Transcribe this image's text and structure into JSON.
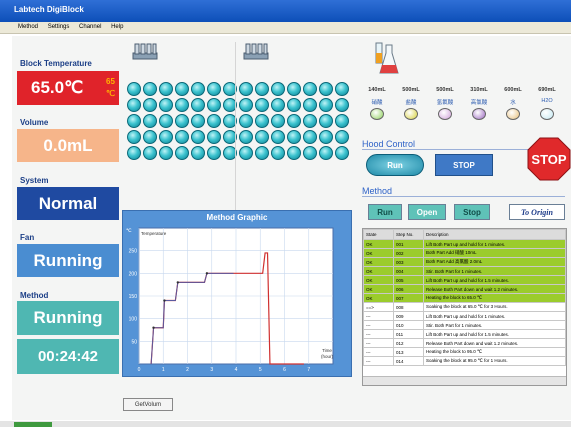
{
  "window": {
    "title": "Labtech DigiBlock"
  },
  "menu": [
    "Method",
    "Settings",
    "Channel",
    "Help"
  ],
  "left": {
    "block_temperature_label": "Block Temperature",
    "block_temperature": "65.0℃",
    "block_setpoint": "65",
    "block_setpoint_unit": "℃",
    "volume_label": "Volume",
    "volume": "0.0mL",
    "system_label": "System",
    "system": "Normal",
    "fan_label": "Fan",
    "fan": "Running",
    "method_label": "Method",
    "method": "Running",
    "elapsed": "00:24:42"
  },
  "reagents": [
    {
      "volume": "140mL",
      "name": "硝酸",
      "color": "#8ed05a"
    },
    {
      "volume": "500mL",
      "name": "盐酸",
      "color": "#d8d23b"
    },
    {
      "volume": "500mL",
      "name": "氢氟酸",
      "color": "#cfa0d8"
    },
    {
      "volume": "310mL",
      "name": "高氯酸",
      "color": "#9a66c0"
    },
    {
      "volume": "600mL",
      "name": "水",
      "color": "#e8c07a"
    },
    {
      "volume": "690mL",
      "name": "H2O",
      "color": "#c3e8f2"
    }
  ],
  "hood": {
    "label": "Hood Control",
    "run": "Run",
    "stop": "STOP"
  },
  "stop_sign": "STOP",
  "method_panel": {
    "label": "Method",
    "run": "Run",
    "open": "Open",
    "stop": "Stop",
    "origin": "To Origin"
  },
  "steps": {
    "headers": [
      "State",
      "Step No.",
      "Description"
    ],
    "rows": [
      {
        "state": "OK",
        "no": "001",
        "desc": "Lift Both Part up and hold for 1 minutes.",
        "done": true
      },
      {
        "state": "OK",
        "no": "002",
        "desc": "Both Part Add 硝酸 10mL",
        "done": true
      },
      {
        "state": "OK",
        "no": "003",
        "desc": "Both Part Add 高氯酸 2.0mL",
        "done": true
      },
      {
        "state": "OK",
        "no": "004",
        "desc": "Stir. Both Part for 1 minutes.",
        "done": true
      },
      {
        "state": "OK",
        "no": "005",
        "desc": "Lift Both Part up and hold for 1.5 minutes.",
        "done": true
      },
      {
        "state": "OK",
        "no": "006",
        "desc": "Release Both Part down and wait 1.2 minutes.",
        "done": true
      },
      {
        "state": "OK",
        "no": "007",
        "desc": "Heating the block to 65.0 ℃",
        "done": true
      },
      {
        "state": "==>",
        "no": "008",
        "desc": "Soaking the block at 65.0 ℃ for 3 Hours.",
        "done": false
      },
      {
        "state": "---",
        "no": "009",
        "desc": "Lift Both Part up and hold for 1 minutes.",
        "done": false
      },
      {
        "state": "---",
        "no": "010",
        "desc": "Stir. Both Part for 1 minutes.",
        "done": false
      },
      {
        "state": "---",
        "no": "011",
        "desc": "Lift Both Part up and hold for 1.5 minutes.",
        "done": false
      },
      {
        "state": "---",
        "no": "012",
        "desc": "Release Both Part down and wait 1.2 minutes.",
        "done": false
      },
      {
        "state": "---",
        "no": "013",
        "desc": "Heating the block to 95.0 ℃",
        "done": false
      },
      {
        "state": "---",
        "no": "014",
        "desc": "Soaking the block at 95.0 ℃ for 1 Hours.",
        "done": false
      }
    ]
  },
  "get_volume": "GetVolum",
  "chart_data": {
    "type": "line",
    "title": "Method Graphic",
    "ylabel": "Temperature",
    "y_unit": "℃",
    "xlabel": "Time",
    "x_unit": "(hour)",
    "xlim": [
      0,
      8
    ],
    "ylim": [
      0,
      300
    ],
    "xticks": [
      0,
      1,
      2,
      3,
      4,
      5,
      6,
      7
    ],
    "yticks": [
      50,
      100,
      150,
      200,
      250
    ],
    "series": [
      {
        "color": "#d03030",
        "x": [
          0.5,
          0.6,
          1,
          1.05,
          1.5,
          1.6,
          2.7,
          2.8,
          5.1,
          5.2,
          5.3,
          5.4,
          6.8
        ],
        "y": [
          0,
          80,
          80,
          140,
          140,
          180,
          180,
          200,
          200,
          245,
          245,
          0,
          0
        ]
      },
      {
        "color": "#5a5aa0",
        "x": [
          0.5,
          0.6,
          1,
          1.05,
          1.5,
          1.6,
          2.7,
          2.8,
          3.9
        ],
        "y": [
          0,
          80,
          80,
          140,
          140,
          180,
          180,
          200,
          200
        ]
      }
    ]
  }
}
